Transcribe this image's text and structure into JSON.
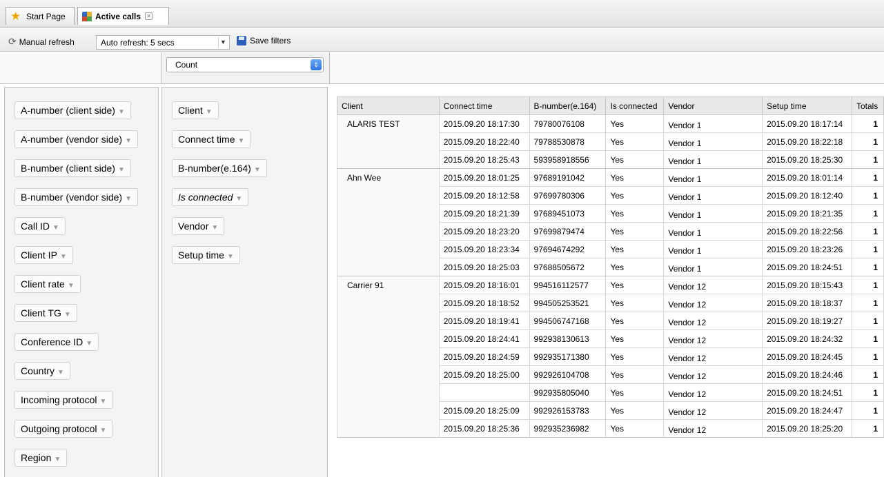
{
  "tabs": [
    {
      "label": "Start Page",
      "icon": "star-icon"
    },
    {
      "label": "Active calls",
      "icon": "grid-icon",
      "active": true
    }
  ],
  "toolbar": {
    "manual_refresh": "Manual refresh",
    "auto_refresh_value": "Auto refresh: 5 secs",
    "save_filters": "Save filters"
  },
  "measure": {
    "value": "Count"
  },
  "left_fields": [
    "A-number (client side)",
    "A-number (vendor side)",
    "B-number (client side)",
    "B-number (vendor side)",
    "Call ID",
    "Client IP",
    "Client rate",
    "Client TG",
    "Conference ID",
    "Country",
    "Incoming protocol",
    "Outgoing protocol",
    "Region"
  ],
  "row_fields": [
    {
      "label": "Client",
      "italic": false
    },
    {
      "label": "Connect time",
      "italic": false
    },
    {
      "label": "B-number(e.164)",
      "italic": false
    },
    {
      "label": "Is connected",
      "italic": true
    },
    {
      "label": "Vendor",
      "italic": false
    },
    {
      "label": "Setup time",
      "italic": false
    }
  ],
  "table": {
    "headers": [
      "Client",
      "Connect time",
      "B-number(e.164)",
      "Is connected",
      "Vendor",
      "Setup time",
      "Totals"
    ],
    "groups": [
      {
        "client": "ALARIS TEST",
        "rows": [
          [
            "2015.09.20 18:17:30",
            "79780076108",
            "Yes",
            "Vendor 1",
            "2015.09.20 18:17:14",
            "1"
          ],
          [
            "2015.09.20 18:22:40",
            "79788530878",
            "Yes",
            "Vendor 1",
            "2015.09.20 18:22:18",
            "1"
          ],
          [
            "2015.09.20 18:25:43",
            "593958918556",
            "Yes",
            "Vendor 1",
            "2015.09.20 18:25:30",
            "1"
          ]
        ]
      },
      {
        "client": "Ahn Wee",
        "rows": [
          [
            "2015.09.20 18:01:25",
            "97689191042",
            "Yes",
            "Vendor 1",
            "2015.09.20 18:01:14",
            "1"
          ],
          [
            "2015.09.20 18:12:58",
            "97699780306",
            "Yes",
            "Vendor 1",
            "2015.09.20 18:12:40",
            "1"
          ],
          [
            "2015.09.20 18:21:39",
            "97689451073",
            "Yes",
            "Vendor 1",
            "2015.09.20 18:21:35",
            "1"
          ],
          [
            "2015.09.20 18:23:20",
            "97699879474",
            "Yes",
            "Vendor 1",
            "2015.09.20 18:22:56",
            "1"
          ],
          [
            "2015.09.20 18:23:34",
            "97694674292",
            "Yes",
            "Vendor 1",
            "2015.09.20 18:23:26",
            "1"
          ],
          [
            "2015.09.20 18:25:03",
            "97688505672",
            "Yes",
            "Vendor 1",
            "2015.09.20 18:24:51",
            "1"
          ]
        ]
      },
      {
        "client": "Carrier 91",
        "rows": [
          [
            "2015.09.20 18:16:01",
            "994516112577",
            "Yes",
            "Vendor 12",
            "2015.09.20 18:15:43",
            "1"
          ],
          [
            "2015.09.20 18:18:52",
            "994505253521",
            "Yes",
            "Vendor 12",
            "2015.09.20 18:18:37",
            "1"
          ],
          [
            "2015.09.20 18:19:41",
            "994506747168",
            "Yes",
            "Vendor 12",
            "2015.09.20 18:19:27",
            "1"
          ],
          [
            "2015.09.20 18:24:41",
            "992938130613",
            "Yes",
            "Vendor 12",
            "2015.09.20 18:24:32",
            "1"
          ],
          [
            "2015.09.20 18:24:59",
            "992935171380",
            "Yes",
            "Vendor 12",
            "2015.09.20 18:24:45",
            "1"
          ],
          [
            "2015.09.20 18:25:00",
            "992926104708",
            "Yes",
            "Vendor 12",
            "2015.09.20 18:24:46",
            "1"
          ],
          [
            "",
            "992935805040",
            "Yes",
            "Vendor 12",
            "2015.09.20 18:24:51",
            "1"
          ],
          [
            "2015.09.20 18:25:09",
            "992926153783",
            "Yes",
            "Vendor 12",
            "2015.09.20 18:24:47",
            "1"
          ],
          [
            "2015.09.20 18:25:36",
            "992935236982",
            "Yes",
            "Vendor 12",
            "2015.09.20 18:25:20",
            "1"
          ]
        ]
      }
    ]
  }
}
